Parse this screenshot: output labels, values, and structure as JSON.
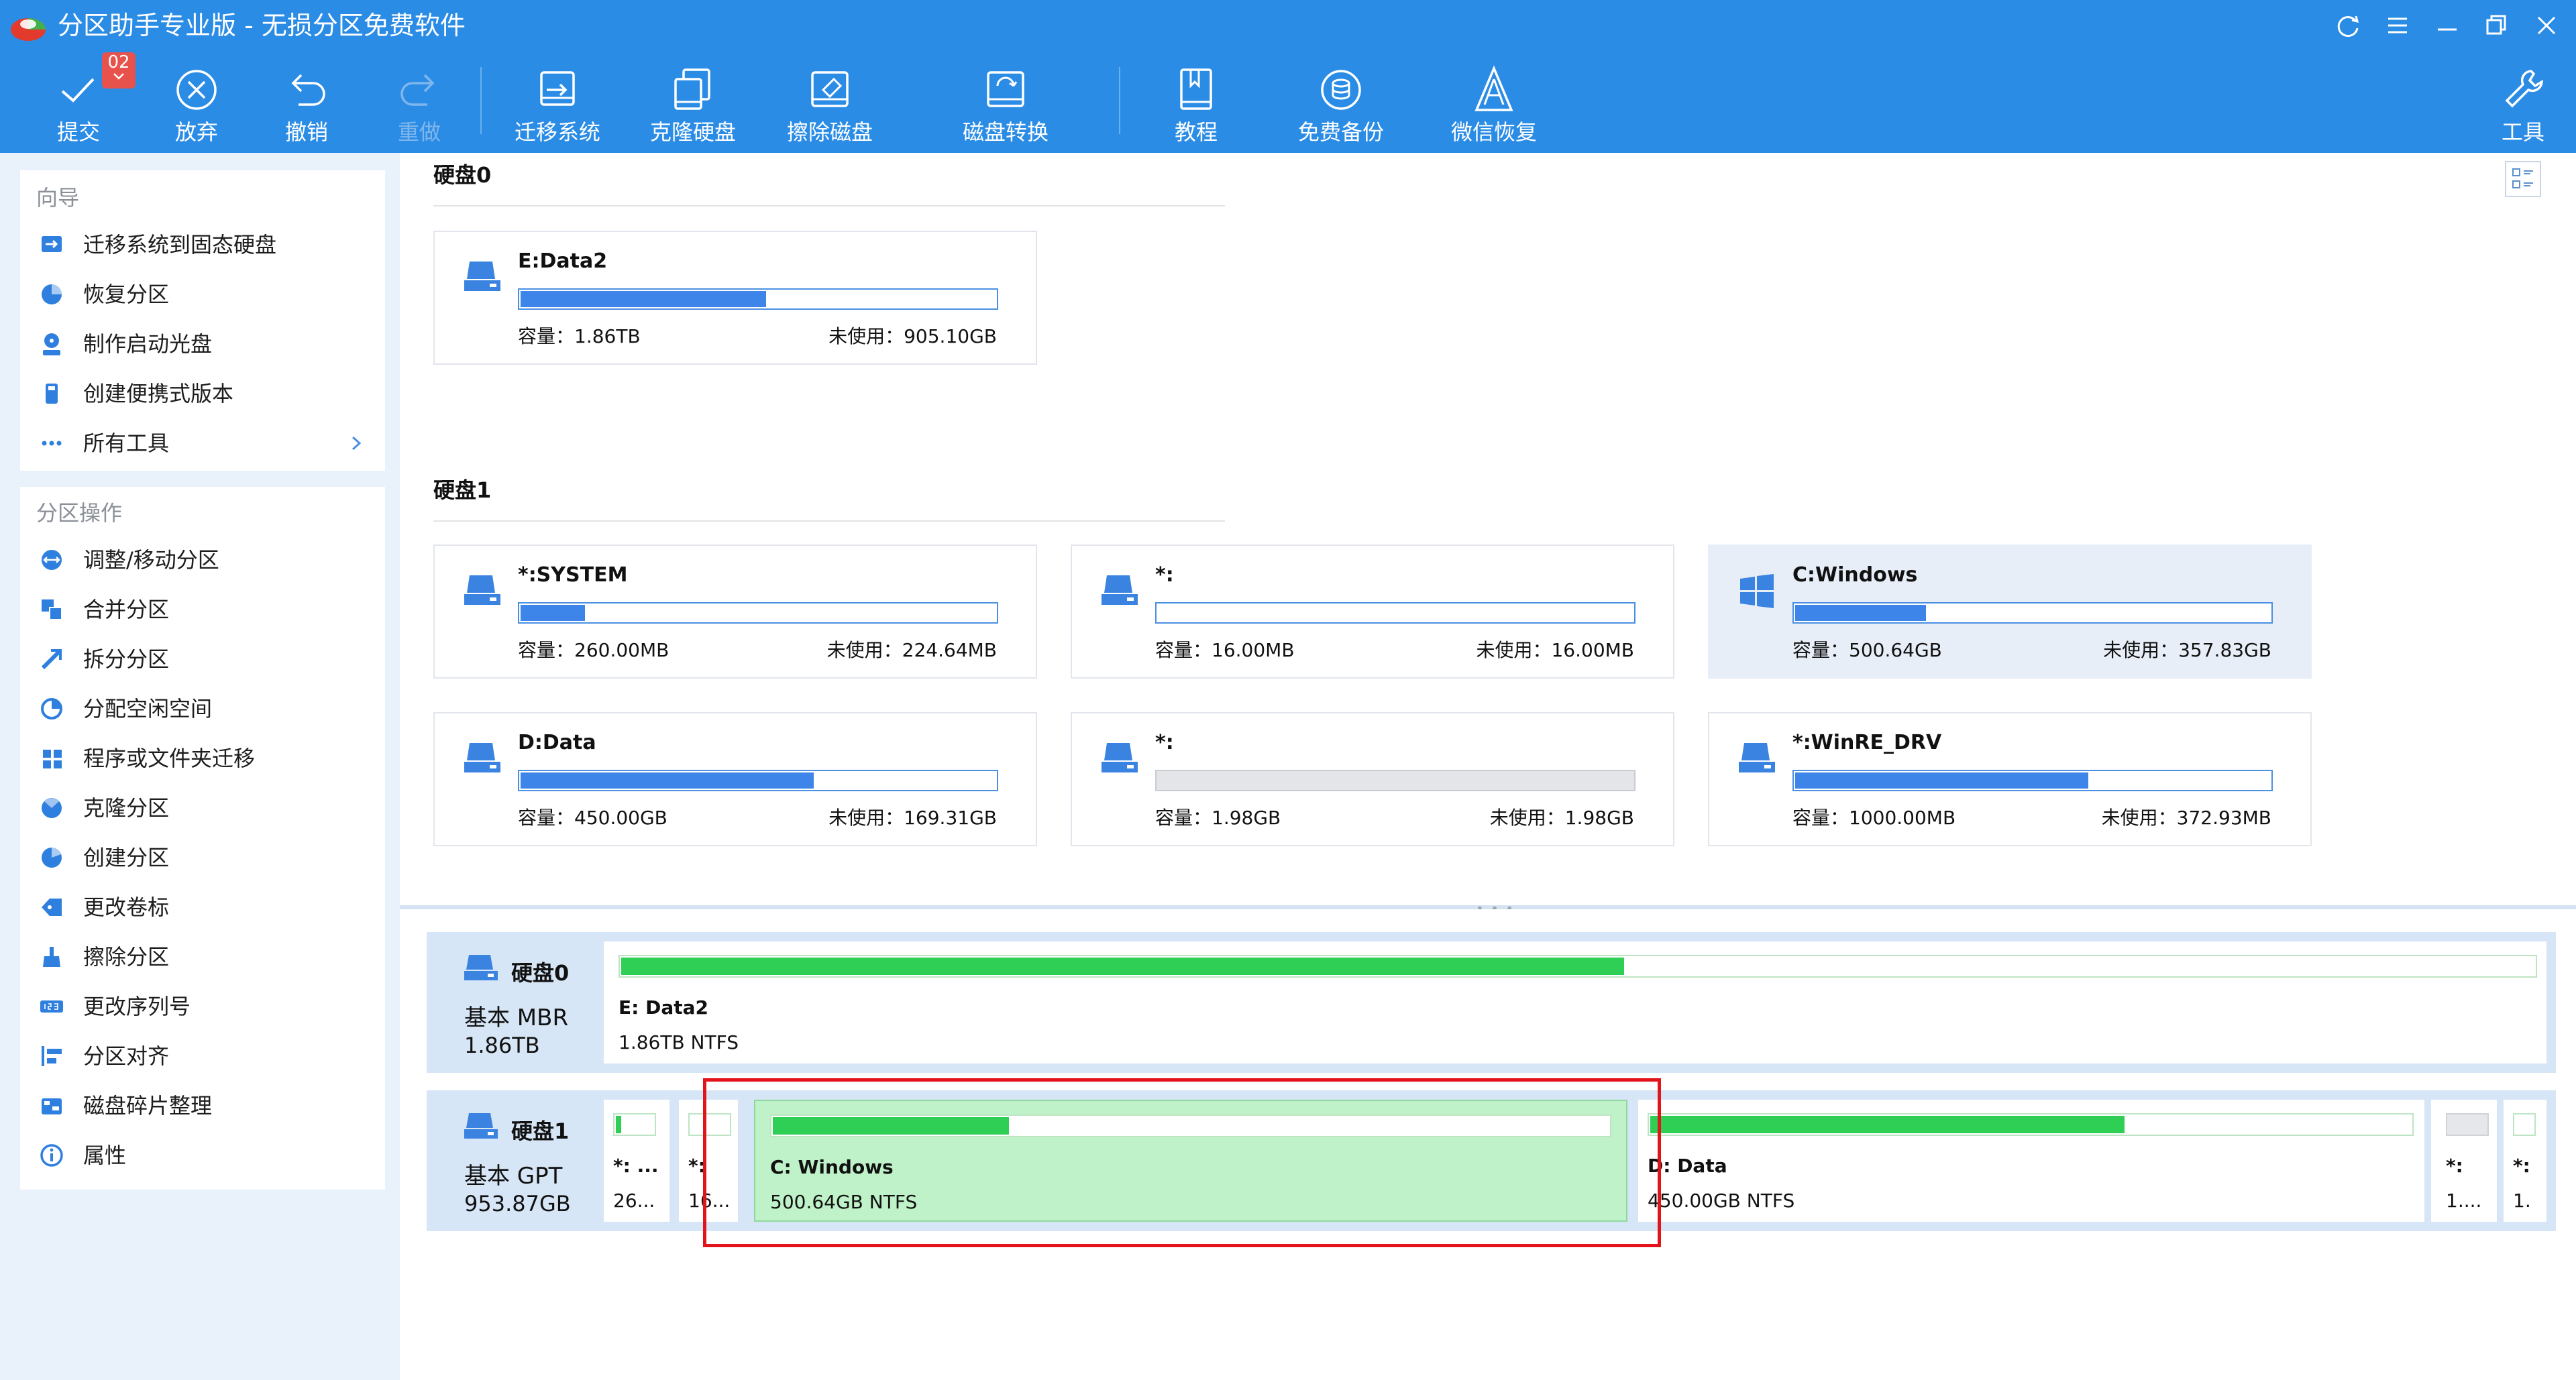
{
  "app": {
    "title": "分区助手专业版 - 无损分区免费软件"
  },
  "toolbar": {
    "commit_badge": "02",
    "items": [
      {
        "label": "提交",
        "icon": "check-icon"
      },
      {
        "label": "放弃",
        "icon": "discard-icon"
      },
      {
        "label": "撤销",
        "icon": "undo-icon"
      },
      {
        "label": "重做",
        "icon": "redo-icon",
        "disabled": true
      },
      {
        "label": "迁移系统",
        "icon": "migrate-system-icon"
      },
      {
        "label": "克隆硬盘",
        "icon": "clone-disk-icon"
      },
      {
        "label": "擦除磁盘",
        "icon": "wipe-disk-icon"
      },
      {
        "label": "磁盘转换",
        "icon": "disk-convert-icon"
      },
      {
        "label": "教程",
        "icon": "tutorial-icon"
      },
      {
        "label": "免费备份",
        "icon": "backup-icon"
      },
      {
        "label": "微信恢复",
        "icon": "wechat-recovery-icon"
      },
      {
        "label": "工具",
        "icon": "tools-icon"
      }
    ]
  },
  "sidebar": {
    "wizard_title": "向导",
    "wizard_items": [
      {
        "label": "迁移系统到固态硬盘",
        "icon": "migrate-ssd-icon"
      },
      {
        "label": "恢复分区",
        "icon": "recover-partition-icon"
      },
      {
        "label": "制作启动光盘",
        "icon": "boot-disc-icon"
      },
      {
        "label": "创建便携式版本",
        "icon": "portable-icon"
      },
      {
        "label": "所有工具",
        "icon": "more-icon"
      }
    ],
    "ops_title": "分区操作",
    "ops_items": [
      {
        "label": "调整/移动分区",
        "icon": "resize-icon"
      },
      {
        "label": "合并分区",
        "icon": "merge-icon"
      },
      {
        "label": "拆分分区",
        "icon": "split-icon"
      },
      {
        "label": "分配空闲空间",
        "icon": "allocate-icon"
      },
      {
        "label": "程序或文件夹迁移",
        "icon": "app-move-icon"
      },
      {
        "label": "克隆分区",
        "icon": "clone-partition-icon"
      },
      {
        "label": "创建分区",
        "icon": "create-partition-icon"
      },
      {
        "label": "更改卷标",
        "icon": "label-icon"
      },
      {
        "label": "擦除分区",
        "icon": "wipe-partition-icon"
      },
      {
        "label": "更改序列号",
        "icon": "serial-icon"
      },
      {
        "label": "分区对齐",
        "icon": "align-icon"
      },
      {
        "label": "磁盘碎片整理",
        "icon": "defrag-icon"
      },
      {
        "label": "属性",
        "icon": "info-icon"
      }
    ]
  },
  "cards_view": {
    "disks": [
      {
        "name": "硬盘0",
        "partitions": [
          {
            "name": "E:Data2",
            "capacity": "容量：1.86TB",
            "free": "未使用：905.10GB",
            "used": 0.52
          }
        ]
      },
      {
        "name": "硬盘1",
        "partitions": [
          {
            "name": "*:SYSTEM",
            "capacity": "容量：260.00MB",
            "free": "未使用：224.64MB",
            "used": 0.14
          },
          {
            "name": "*:",
            "capacity": "容量：16.00MB",
            "free": "未使用：16.00MB",
            "used": 0
          },
          {
            "name": "C:Windows",
            "capacity": "容量：500.64GB",
            "free": "未使用：357.83GB",
            "used": 0.28,
            "selected": true,
            "icon": "windows-icon"
          },
          {
            "name": "D:Data",
            "capacity": "容量：450.00GB",
            "free": "未使用：169.31GB",
            "used": 0.62
          },
          {
            "name": "*:",
            "capacity": "容量：1.98GB",
            "free": "未使用：1.98GB",
            "used": 0,
            "unformatted": true
          },
          {
            "name": "*:WinRE_DRV",
            "capacity": "容量：1000.00MB",
            "free": "未使用：372.93MB",
            "used": 0.62
          }
        ]
      }
    ]
  },
  "map_view": {
    "disks": [
      {
        "name": "硬盘0",
        "type": "基本 MBR",
        "size": "1.86TB",
        "partitions": [
          {
            "name": "E: Data2",
            "info": "1.86TB NTFS",
            "used": 0.525
          }
        ]
      },
      {
        "name": "硬盘1",
        "type": "基本 GPT",
        "size": "953.87GB",
        "partitions": [
          {
            "name": "*: ...",
            "info": "26...",
            "used": 0.2
          },
          {
            "name": "*:",
            "info": "16...",
            "used": 0
          },
          {
            "name": "C: Windows",
            "info": "500.64GB NTFS",
            "used": 0.285,
            "selected": true
          },
          {
            "name": "D: Data",
            "info": "450.00GB NTFS",
            "used": 0.625
          },
          {
            "name": "*:",
            "info": "1....",
            "used": 0,
            "unformatted": true
          },
          {
            "name": "*:",
            "info": "1.",
            "used": 0
          }
        ]
      }
    ]
  },
  "colors": {
    "titlebar": "#2b8ce6",
    "card_bar_fill": "#3d85e8",
    "map_bar_fill": "#2fcf55",
    "selected_block": "#bff2c8",
    "highlight_box": "#e3131c"
  }
}
